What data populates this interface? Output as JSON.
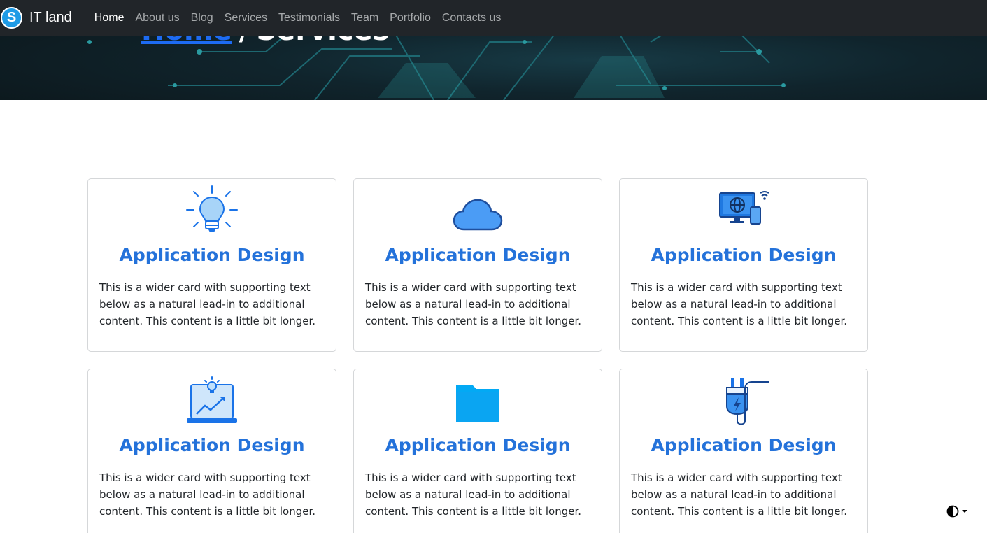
{
  "brand": {
    "logo_letter": "S",
    "name": "IT land"
  },
  "nav": [
    {
      "label": "Home",
      "active": true
    },
    {
      "label": "About us"
    },
    {
      "label": "Blog"
    },
    {
      "label": "Services"
    },
    {
      "label": "Testimonials"
    },
    {
      "label": "Team"
    },
    {
      "label": "Portfolio"
    },
    {
      "label": "Contacts us"
    }
  ],
  "breadcrumb": {
    "home": "Home",
    "separator": "/",
    "current": "Services"
  },
  "cards": [
    {
      "icon": "lightbulb-icon",
      "title": "Application Design",
      "text": "This is a wider card with supporting text below as a natural lead-in to additional content. This content is a little bit longer."
    },
    {
      "icon": "cloud-icon",
      "title": "Application Design",
      "text": "This is a wider card with supporting text below as a natural lead-in to additional content. This content is a little bit longer."
    },
    {
      "icon": "monitor-globe-icon",
      "title": "Application Design",
      "text": "This is a wider card with supporting text below as a natural lead-in to additional content. This content is a little bit longer."
    },
    {
      "icon": "laptop-growth-icon",
      "title": "Application Design",
      "text": "This is a wider card with supporting text below as a natural lead-in to additional content. This content is a little bit longer."
    },
    {
      "icon": "folder-icon",
      "title": "Application Design",
      "text": "This is a wider card with supporting text below as a natural lead-in to additional content. This content is a little bit longer."
    },
    {
      "icon": "power-plug-icon",
      "title": "Application Design",
      "text": "This is a wider card with supporting text below as a natural lead-in to additional content. This content is a little bit longer."
    }
  ],
  "theme_toggle": {
    "icon": "contrast-icon"
  },
  "colors": {
    "navbar": "#212529",
    "accent": "#2472da",
    "link": "#1d6bf3"
  }
}
